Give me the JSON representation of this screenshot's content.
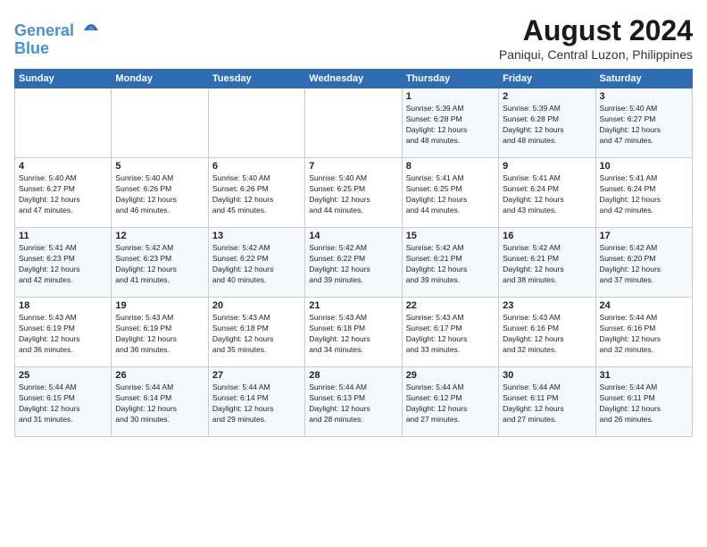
{
  "header": {
    "logo_line1": "General",
    "logo_line2": "Blue",
    "month_year": "August 2024",
    "location": "Paniqui, Central Luzon, Philippines"
  },
  "days_of_week": [
    "Sunday",
    "Monday",
    "Tuesday",
    "Wednesday",
    "Thursday",
    "Friday",
    "Saturday"
  ],
  "weeks": [
    [
      {
        "day": "",
        "content": ""
      },
      {
        "day": "",
        "content": ""
      },
      {
        "day": "",
        "content": ""
      },
      {
        "day": "",
        "content": ""
      },
      {
        "day": "1",
        "content": "Sunrise: 5:39 AM\nSunset: 6:28 PM\nDaylight: 12 hours\nand 48 minutes."
      },
      {
        "day": "2",
        "content": "Sunrise: 5:39 AM\nSunset: 6:28 PM\nDaylight: 12 hours\nand 48 minutes."
      },
      {
        "day": "3",
        "content": "Sunrise: 5:40 AM\nSunset: 6:27 PM\nDaylight: 12 hours\nand 47 minutes."
      }
    ],
    [
      {
        "day": "4",
        "content": "Sunrise: 5:40 AM\nSunset: 6:27 PM\nDaylight: 12 hours\nand 47 minutes."
      },
      {
        "day": "5",
        "content": "Sunrise: 5:40 AM\nSunset: 6:26 PM\nDaylight: 12 hours\nand 46 minutes."
      },
      {
        "day": "6",
        "content": "Sunrise: 5:40 AM\nSunset: 6:26 PM\nDaylight: 12 hours\nand 45 minutes."
      },
      {
        "day": "7",
        "content": "Sunrise: 5:40 AM\nSunset: 6:25 PM\nDaylight: 12 hours\nand 44 minutes."
      },
      {
        "day": "8",
        "content": "Sunrise: 5:41 AM\nSunset: 6:25 PM\nDaylight: 12 hours\nand 44 minutes."
      },
      {
        "day": "9",
        "content": "Sunrise: 5:41 AM\nSunset: 6:24 PM\nDaylight: 12 hours\nand 43 minutes."
      },
      {
        "day": "10",
        "content": "Sunrise: 5:41 AM\nSunset: 6:24 PM\nDaylight: 12 hours\nand 42 minutes."
      }
    ],
    [
      {
        "day": "11",
        "content": "Sunrise: 5:41 AM\nSunset: 6:23 PM\nDaylight: 12 hours\nand 42 minutes."
      },
      {
        "day": "12",
        "content": "Sunrise: 5:42 AM\nSunset: 6:23 PM\nDaylight: 12 hours\nand 41 minutes."
      },
      {
        "day": "13",
        "content": "Sunrise: 5:42 AM\nSunset: 6:22 PM\nDaylight: 12 hours\nand 40 minutes."
      },
      {
        "day": "14",
        "content": "Sunrise: 5:42 AM\nSunset: 6:22 PM\nDaylight: 12 hours\nand 39 minutes."
      },
      {
        "day": "15",
        "content": "Sunrise: 5:42 AM\nSunset: 6:21 PM\nDaylight: 12 hours\nand 39 minutes."
      },
      {
        "day": "16",
        "content": "Sunrise: 5:42 AM\nSunset: 6:21 PM\nDaylight: 12 hours\nand 38 minutes."
      },
      {
        "day": "17",
        "content": "Sunrise: 5:42 AM\nSunset: 6:20 PM\nDaylight: 12 hours\nand 37 minutes."
      }
    ],
    [
      {
        "day": "18",
        "content": "Sunrise: 5:43 AM\nSunset: 6:19 PM\nDaylight: 12 hours\nand 36 minutes."
      },
      {
        "day": "19",
        "content": "Sunrise: 5:43 AM\nSunset: 6:19 PM\nDaylight: 12 hours\nand 36 minutes."
      },
      {
        "day": "20",
        "content": "Sunrise: 5:43 AM\nSunset: 6:18 PM\nDaylight: 12 hours\nand 35 minutes."
      },
      {
        "day": "21",
        "content": "Sunrise: 5:43 AM\nSunset: 6:18 PM\nDaylight: 12 hours\nand 34 minutes."
      },
      {
        "day": "22",
        "content": "Sunrise: 5:43 AM\nSunset: 6:17 PM\nDaylight: 12 hours\nand 33 minutes."
      },
      {
        "day": "23",
        "content": "Sunrise: 5:43 AM\nSunset: 6:16 PM\nDaylight: 12 hours\nand 32 minutes."
      },
      {
        "day": "24",
        "content": "Sunrise: 5:44 AM\nSunset: 6:16 PM\nDaylight: 12 hours\nand 32 minutes."
      }
    ],
    [
      {
        "day": "25",
        "content": "Sunrise: 5:44 AM\nSunset: 6:15 PM\nDaylight: 12 hours\nand 31 minutes."
      },
      {
        "day": "26",
        "content": "Sunrise: 5:44 AM\nSunset: 6:14 PM\nDaylight: 12 hours\nand 30 minutes."
      },
      {
        "day": "27",
        "content": "Sunrise: 5:44 AM\nSunset: 6:14 PM\nDaylight: 12 hours\nand 29 minutes."
      },
      {
        "day": "28",
        "content": "Sunrise: 5:44 AM\nSunset: 6:13 PM\nDaylight: 12 hours\nand 28 minutes."
      },
      {
        "day": "29",
        "content": "Sunrise: 5:44 AM\nSunset: 6:12 PM\nDaylight: 12 hours\nand 27 minutes."
      },
      {
        "day": "30",
        "content": "Sunrise: 5:44 AM\nSunset: 6:11 PM\nDaylight: 12 hours\nand 27 minutes."
      },
      {
        "day": "31",
        "content": "Sunrise: 5:44 AM\nSunset: 6:11 PM\nDaylight: 12 hours\nand 26 minutes."
      }
    ]
  ]
}
